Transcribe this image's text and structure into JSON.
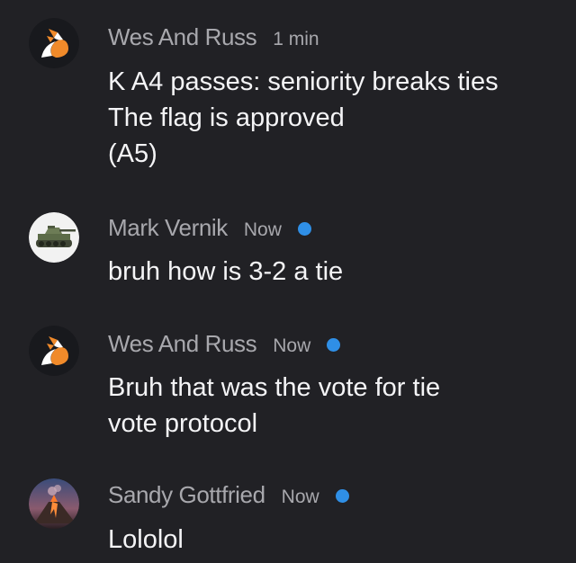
{
  "colors": {
    "background": "#212125",
    "author_text": "#a8a8ad",
    "message_text": "#f4f4f6",
    "unread_dot": "#2f8fe6"
  },
  "messages": [
    {
      "author": "Wes And Russ",
      "time": "1 min",
      "avatar_icon": "fox-logo-icon",
      "unread": false,
      "lines": [
        "K A4 passes: seniority breaks ties",
        "The flag is approved",
        "(A5)"
      ]
    },
    {
      "author": "Mark Vernik",
      "time": "Now",
      "avatar_icon": "tank-icon",
      "unread": true,
      "lines": [
        "bruh how is 3-2 a tie"
      ]
    },
    {
      "author": "Wes And Russ",
      "time": "Now",
      "avatar_icon": "fox-logo-icon",
      "unread": true,
      "lines": [
        "Bruh that was the vote for tie",
        "vote protocol"
      ]
    },
    {
      "author": "Sandy Gottfried",
      "time": "Now",
      "avatar_icon": "volcano-icon",
      "unread": true,
      "lines": [
        "Lololol"
      ]
    }
  ]
}
